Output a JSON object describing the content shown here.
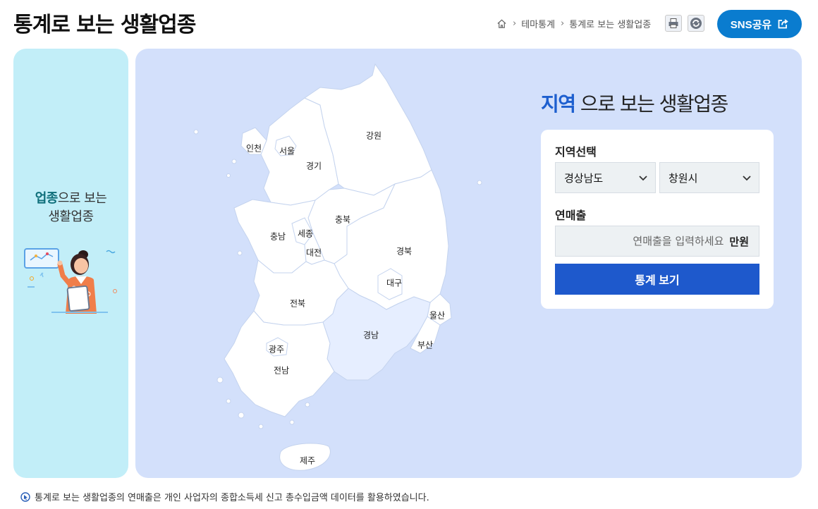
{
  "header": {
    "title": "통계로 보는 생활업종",
    "breadcrumb": [
      "테마통계",
      "통계로 보는 생활업종"
    ],
    "sns_label": "SNS공유"
  },
  "left_panel": {
    "highlight": "업종",
    "text_rest": "으로 보는",
    "line2": "생활업종"
  },
  "map": {
    "regions": [
      "인천",
      "서울",
      "경기",
      "강원",
      "충북",
      "충남",
      "세종",
      "대전",
      "경북",
      "대구",
      "전북",
      "울산",
      "경남",
      "부산",
      "광주",
      "전남",
      "제주"
    ],
    "selected_region": "경남"
  },
  "form": {
    "title_highlight": "지역",
    "title_rest": " 으로 보는 생활업종",
    "region_label": "지역선택",
    "province_value": "경상남도",
    "city_value": "창원시",
    "sales_label": "연매출",
    "sales_placeholder": "연매출을 입력하세요",
    "sales_unit": "만원",
    "submit_label": "통계 보기"
  },
  "footnote": "통계로 보는 생활업종의 연매출은 개인 사업자의 종합소득세 신고 총수입금액 데이터를 활용하였습니다.",
  "colors": {
    "accent_blue": "#1e59cc",
    "sns_blue": "#0a7ccf",
    "left_panel_bg": "#c2eef8",
    "map_panel_bg": "#d3e0fb",
    "selected_region_fill": "#e6eeff"
  }
}
